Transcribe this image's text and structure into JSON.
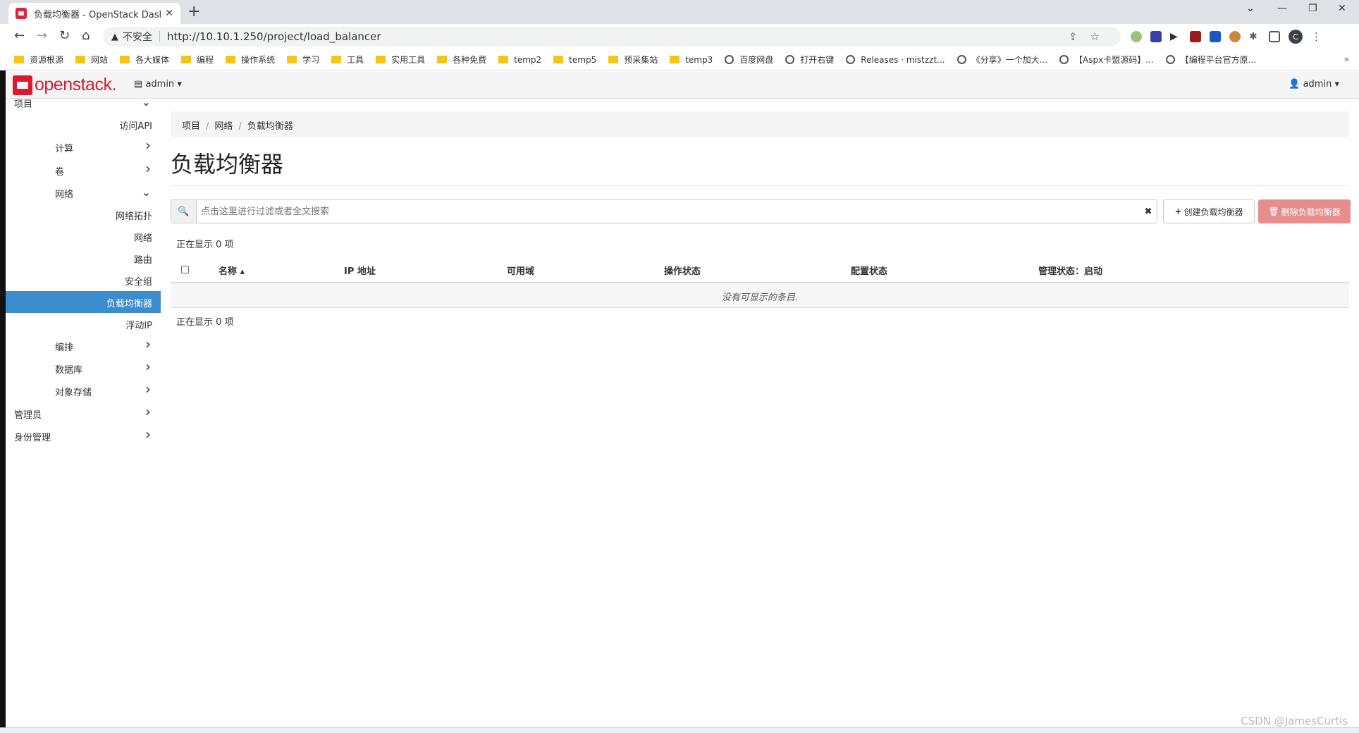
{
  "browser": {
    "tab_title": "负载均衡器 - OpenStack Dashb",
    "insecure_label": "不安全",
    "url": "http://10.10.1.250/project/load_balancer",
    "profile_initial": "C",
    "bookmarks": [
      {
        "label": "资源根源",
        "kind": "folder"
      },
      {
        "label": "网站",
        "kind": "folder"
      },
      {
        "label": "各大媒体",
        "kind": "folder"
      },
      {
        "label": "编程",
        "kind": "folder"
      },
      {
        "label": "操作系统",
        "kind": "folder"
      },
      {
        "label": "学习",
        "kind": "folder"
      },
      {
        "label": "工具",
        "kind": "folder"
      },
      {
        "label": "实用工具",
        "kind": "folder"
      },
      {
        "label": "各种免费",
        "kind": "folder"
      },
      {
        "label": "temp2",
        "kind": "folder"
      },
      {
        "label": "temp5",
        "kind": "folder"
      },
      {
        "label": "预采集站",
        "kind": "folder"
      },
      {
        "label": "temp3",
        "kind": "folder"
      },
      {
        "label": "百度网盘",
        "kind": "globe"
      },
      {
        "label": "打开右键",
        "kind": "globe"
      },
      {
        "label": "Releases · mistzzt...",
        "kind": "github"
      },
      {
        "label": "《分享》一个加大...",
        "kind": "paw"
      },
      {
        "label": "【Aspx卡盟源码】...",
        "kind": "site"
      },
      {
        "label": "【编程平台官方原...",
        "kind": "globe"
      }
    ]
  },
  "app": {
    "logo_text": "openstack.",
    "project_selector": "admin",
    "user_menu": "admin"
  },
  "sidebar": {
    "items": [
      {
        "label": "项目",
        "level": 0,
        "chevron": "down"
      },
      {
        "label": "访问API",
        "level": 2,
        "chevron": ""
      },
      {
        "label": "计算",
        "level": 1,
        "chevron": "right"
      },
      {
        "label": "卷",
        "level": 1,
        "chevron": "right"
      },
      {
        "label": "网络",
        "level": 1,
        "chevron": "down"
      },
      {
        "label": "网络拓扑",
        "level": 2,
        "chevron": ""
      },
      {
        "label": "网络",
        "level": 2,
        "chevron": ""
      },
      {
        "label": "路由",
        "level": 2,
        "chevron": ""
      },
      {
        "label": "安全组",
        "level": 2,
        "chevron": ""
      },
      {
        "label": "负载均衡器",
        "level": 2,
        "chevron": "",
        "active": true
      },
      {
        "label": "浮动IP",
        "level": 2,
        "chevron": ""
      },
      {
        "label": "编排",
        "level": 1,
        "chevron": "right"
      },
      {
        "label": "数据库",
        "level": 1,
        "chevron": "right"
      },
      {
        "label": "对象存储",
        "level": 1,
        "chevron": "right"
      },
      {
        "label": "管理员",
        "level": 0,
        "chevron": "right"
      },
      {
        "label": "身份管理",
        "level": 0,
        "chevron": "right"
      }
    ]
  },
  "breadcrumb": [
    "项目",
    "网络",
    "负载均衡器"
  ],
  "page_title": "负载均衡器",
  "filter": {
    "placeholder": "点击这里进行过滤或者全文搜索",
    "clear_glyph": "✖"
  },
  "actions": {
    "create_label": "创建负载均衡器",
    "delete_label": "删除负载均衡器"
  },
  "table": {
    "count_text": "正在显示 0 项",
    "columns": [
      "名称",
      "IP 地址",
      "可用域",
      "操作状态",
      "配置状态",
      "管理状态：启动"
    ],
    "empty_text": "没有可显示的条目."
  },
  "watermark": "CSDN @JamesCurtis",
  "colors": {
    "brand": "#da1a32",
    "active_nav": "#3c8dd0",
    "delete_button": "#e88d8d"
  }
}
